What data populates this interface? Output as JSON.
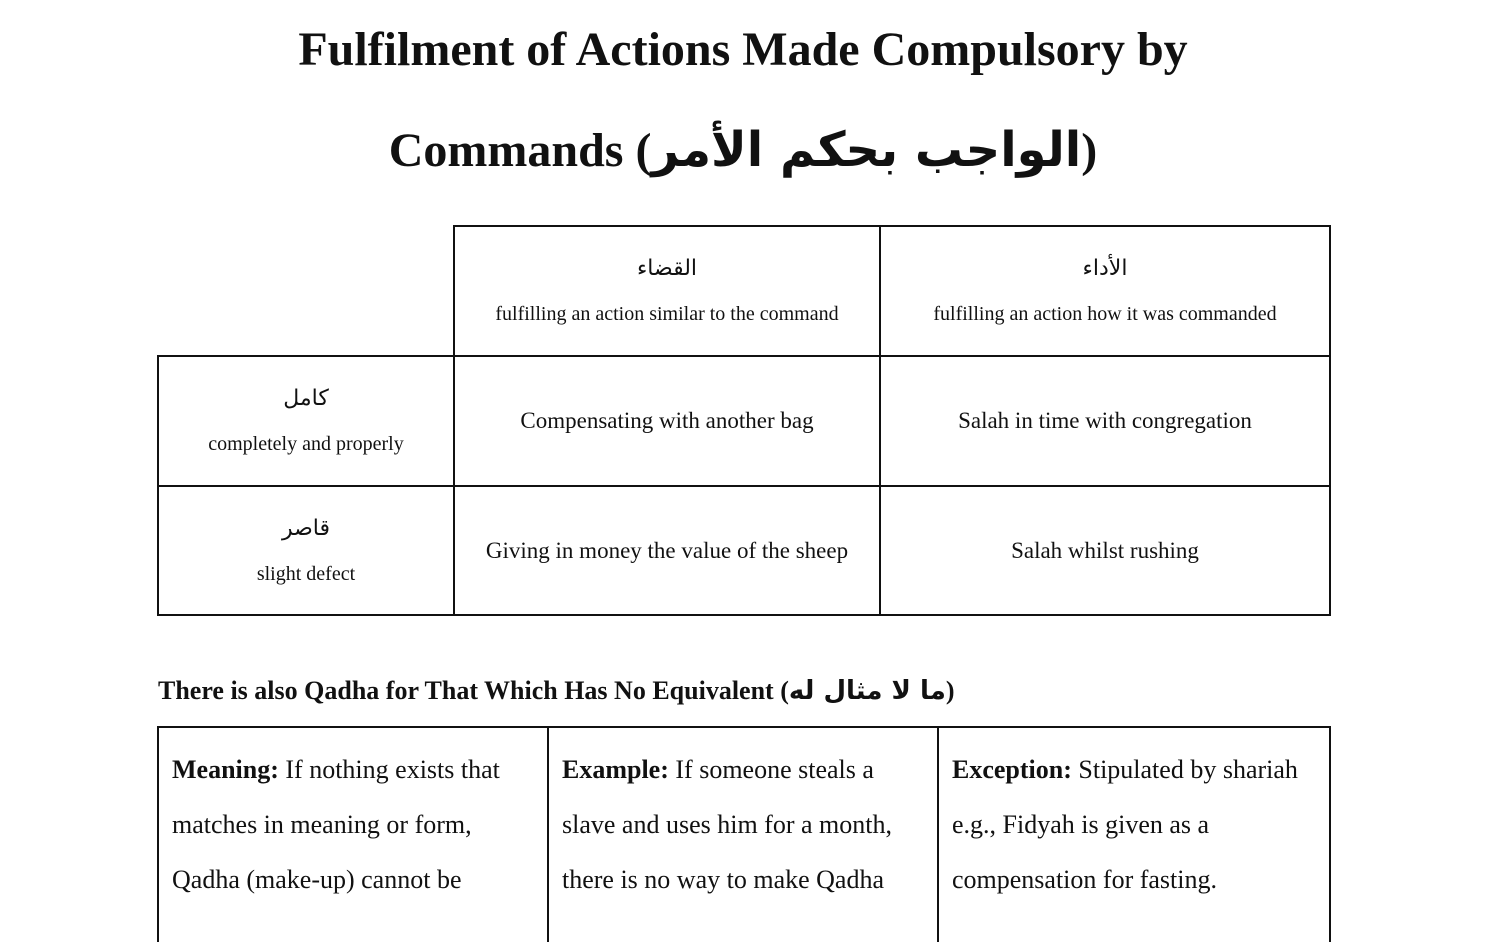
{
  "title": {
    "line1": "Fulfilment of Actions Made Compulsory by",
    "line2_prefix": "Commands (",
    "line2_arabic": "الواجب بحكم الأمر",
    "line2_suffix": ")"
  },
  "table": {
    "columns": [
      {
        "arabic": "القضاء",
        "meaning": "fulfilling an action similar to the command"
      },
      {
        "arabic": "الأداء",
        "meaning": "fulfilling an action how it was commanded"
      }
    ],
    "rows": [
      {
        "arabic": "كامل",
        "meaning": "completely and properly",
        "cells": [
          "Compensating with another bag",
          "Salah in time with congregation"
        ]
      },
      {
        "arabic": "قاصر",
        "meaning": "slight defect",
        "cells": [
          "Giving in money the value of the sheep",
          "Salah whilst rushing"
        ]
      }
    ]
  },
  "section": {
    "heading_prefix": "There is also Qadha for That Which Has No Equivalent (",
    "heading_arabic": "ما لا مثال له",
    "heading_suffix": ")",
    "notes": [
      {
        "label": "Meaning:",
        "text": " If nothing exists that matches in meaning or form, Qadha (make-up) cannot be"
      },
      {
        "label": "Example:",
        "text": " If someone steals a slave and uses him for a month, there is no way to make Qadha"
      },
      {
        "label": "Exception:",
        "text": " Stipulated by shariah e.g., Fidyah is given as a compensation for fasting."
      }
    ]
  }
}
